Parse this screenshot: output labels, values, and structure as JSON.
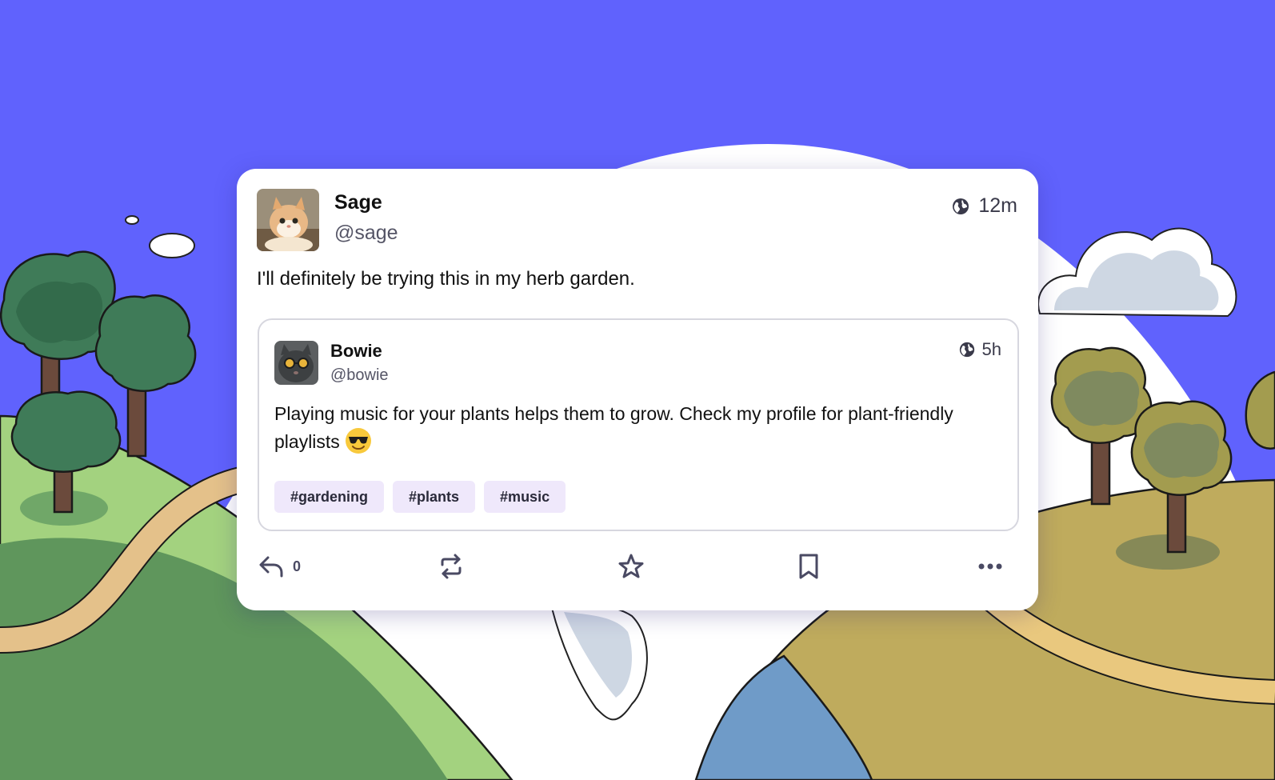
{
  "post": {
    "author": {
      "name": "Sage",
      "handle": "@sage"
    },
    "visibility_icon": "globe-icon",
    "time": "12m",
    "text": "I'll definitely be trying this in my herb garden.",
    "quote": {
      "author": {
        "name": "Bowie",
        "handle": "@bowie"
      },
      "visibility_icon": "globe-icon",
      "time": "5h",
      "text": "Playing music for your plants helps them to grow. Check my profile for plant-friendly playlists",
      "emoji": "smiling-face-with-sunglasses",
      "tags": [
        "#gardening",
        "#plants",
        "#music"
      ]
    },
    "actions": {
      "reply_icon": "reply-icon",
      "reply_count": "0",
      "boost_icon": "repost-icon",
      "favourite_icon": "star-icon",
      "bookmark_icon": "bookmark-icon",
      "more_icon": "more-icon"
    }
  },
  "colors": {
    "sky": "#6062fd",
    "card_background": "#ffffff",
    "tag_background": "#efe8fb",
    "icon": "#4a4a63"
  }
}
